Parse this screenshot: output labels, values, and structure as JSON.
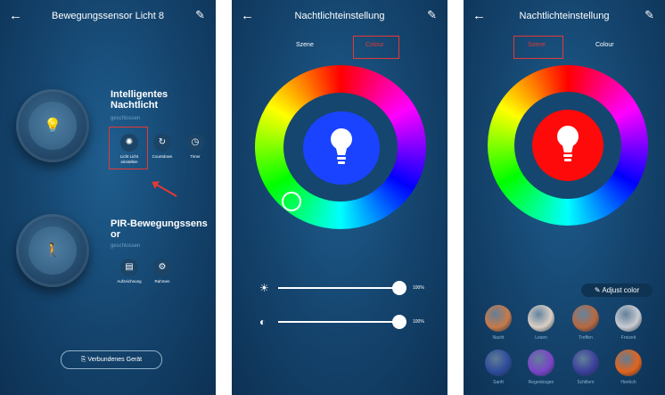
{
  "panel1": {
    "title": "Bewegungssensor Licht 8",
    "devices": [
      {
        "name_line1": "Intelligentes",
        "name_line2": "Nachtlicht",
        "state": "geschlossen",
        "glyph": "lightbulb-icon",
        "actions": [
          {
            "label_line1": "Licht Licht",
            "label_line2": "einstellen",
            "icon": "sun-icon"
          },
          {
            "label_line1": "Countdown",
            "label_line2": "",
            "icon": "countdown-icon"
          },
          {
            "label_line1": "Timer",
            "label_line2": "",
            "icon": "clock-icon"
          }
        ]
      },
      {
        "name_line1": "PIR-Bewegungssens",
        "name_line2": "or",
        "state": "geschlossen",
        "glyph": "motion-icon",
        "actions": [
          {
            "label_line1": "Aufzeichnung",
            "label_line2": "",
            "icon": "record-icon"
          },
          {
            "label_line1": "Rahmen",
            "label_line2": "",
            "icon": "settings-icon"
          }
        ]
      }
    ],
    "linked_button": "Verbundenes Gerät"
  },
  "panel2": {
    "title": "Nachtlichteinstellung",
    "tabs": [
      "Szene",
      "Colour"
    ],
    "selected_tab": "Colour",
    "selected_color": "#1a43ff",
    "brightness_pct": "100%",
    "contrast_pct": "100%"
  },
  "panel3": {
    "title": "Nachtlichteinstellung",
    "tabs": [
      "Szene",
      "Colour"
    ],
    "selected_tab": "Szene",
    "selected_color": "#ff0a0a",
    "adjust_label": "Adjust color",
    "scenes": [
      {
        "name": "Nacht",
        "color": "#c77a4a"
      },
      {
        "name": "Lesen",
        "color": "#d9cfc4"
      },
      {
        "name": "Treffen",
        "color": "#b8683f"
      },
      {
        "name": "Freizeit",
        "color": "#c9ccd2"
      },
      {
        "name": "Sanft",
        "color": "#2d4b9a"
      },
      {
        "name": "Regenbogen",
        "color": "#7a44c8"
      },
      {
        "name": "Schillern",
        "color": "#3a3f9a"
      },
      {
        "name": "Herrlich",
        "color": "#e2641c"
      }
    ]
  },
  "icons": {
    "back": "←",
    "edit": "✎",
    "bulb": "💡",
    "sun": "✺",
    "countdown": "↻",
    "clock": "◷",
    "record": "▤",
    "gear": "⚙",
    "walk": "🚶",
    "link": "⎘",
    "brightness": "☀",
    "contrast": "◐",
    "pen": "✎"
  },
  "colors": {
    "highlight": "#e53935",
    "background": "#14436c"
  }
}
